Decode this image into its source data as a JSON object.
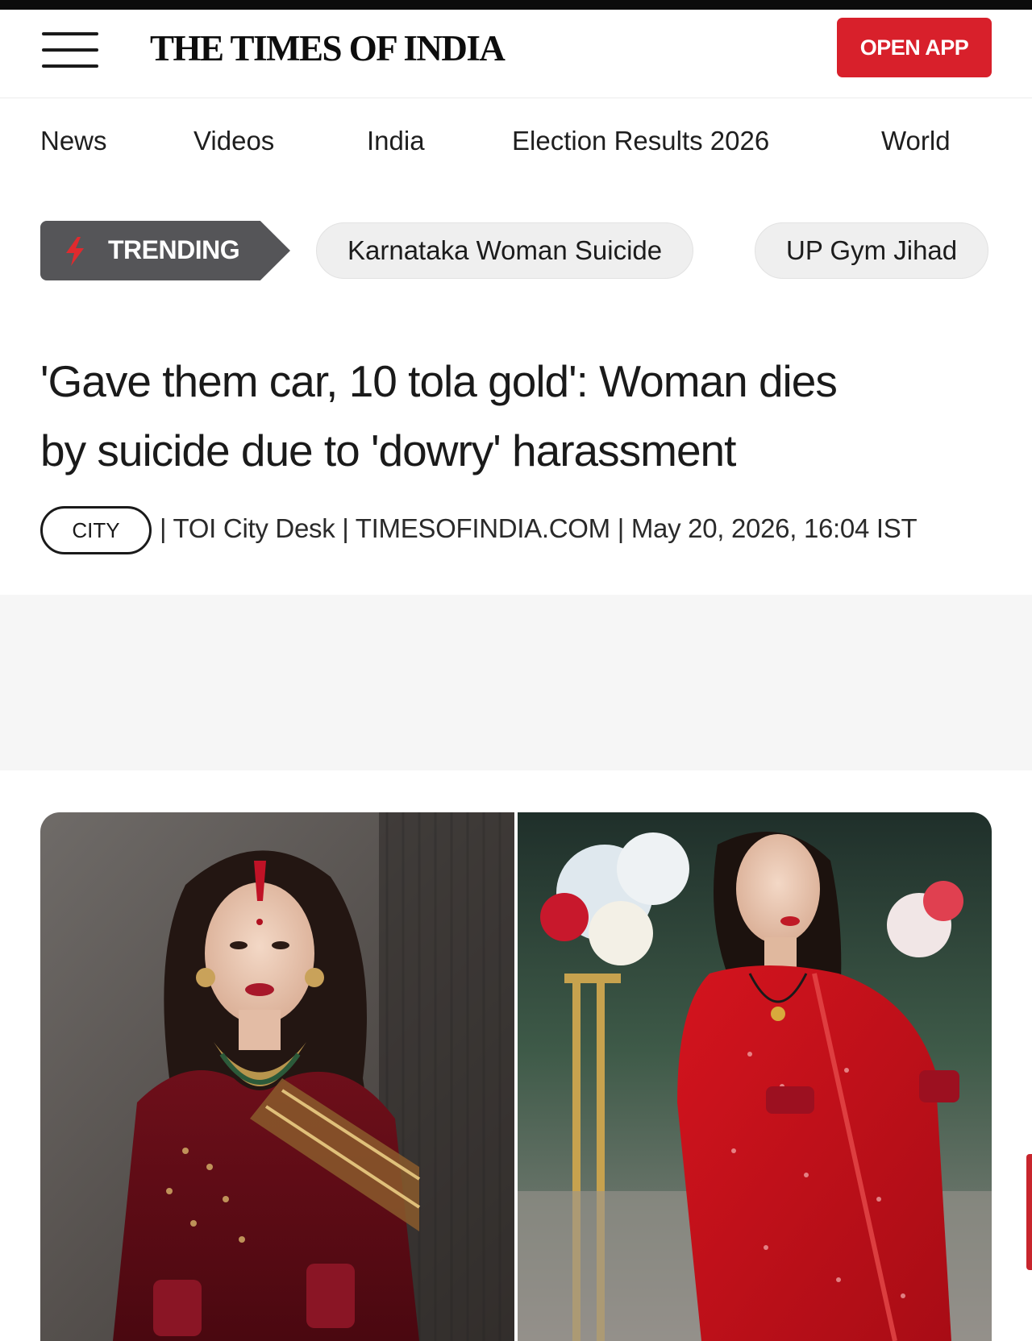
{
  "header": {
    "logo": "THE TIMES OF INDIA",
    "open_app_label": "OPEN APP"
  },
  "nav": {
    "items": [
      "News",
      "Videos",
      "India",
      "Election Results 2026",
      "World"
    ]
  },
  "trending": {
    "label": "TRENDING",
    "chips": [
      "Karnataka Woman Suicide",
      "UP Gym Jihad"
    ]
  },
  "article": {
    "headline_line1": "'Gave them car, 10 tola gold': Woman dies",
    "headline_line2": "by suicide due to 'dowry' harassment",
    "category": "CITY",
    "meta": "| TOI City Desk | TIMESOFINDIA.COM | May 20, 2026, 16:04 IST"
  },
  "colors": {
    "brand_red": "#d8202b",
    "trending_bg": "#555558",
    "chip_bg": "#efefef"
  },
  "icons": {
    "menu": "hamburger-menu-icon",
    "trending": "lightning-bolt-icon"
  }
}
